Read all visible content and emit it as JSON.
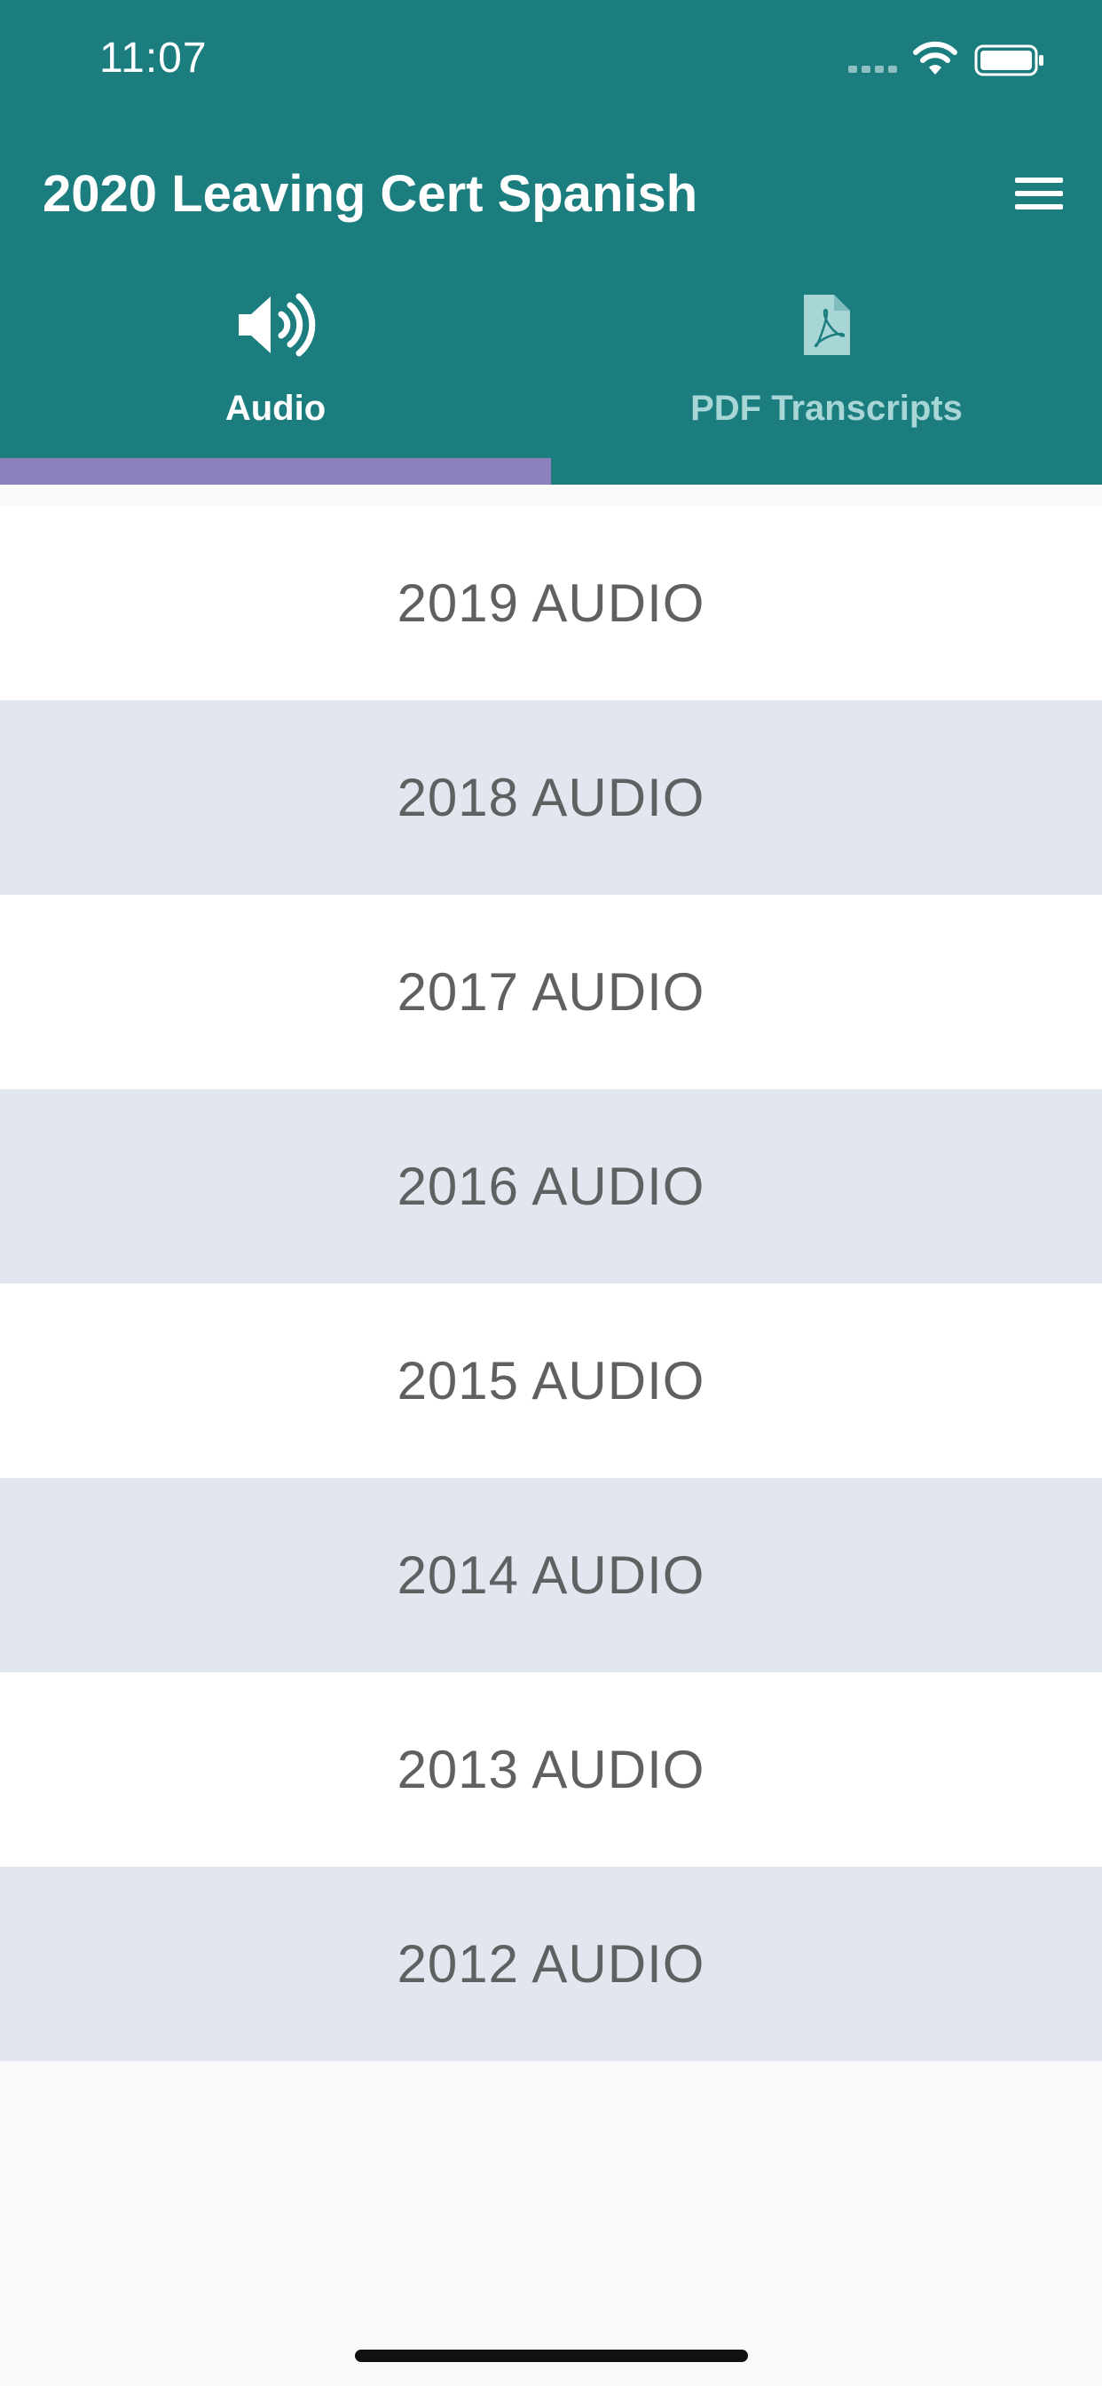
{
  "status_bar": {
    "time": "11:07"
  },
  "app_bar": {
    "title": "2020 Leaving Cert Spanish",
    "menu_icon": "hamburger-menu-icon"
  },
  "tabs": [
    {
      "label": "Audio",
      "icon": "speaker-icon",
      "selected": true
    },
    {
      "label": "PDF Transcripts",
      "icon": "pdf-file-icon",
      "selected": false
    }
  ],
  "audio_list": {
    "items": [
      {
        "label": "2019 AUDIO"
      },
      {
        "label": "2018 AUDIO"
      },
      {
        "label": "2017 AUDIO"
      },
      {
        "label": "2016 AUDIO"
      },
      {
        "label": "2015 AUDIO"
      },
      {
        "label": "2014 AUDIO"
      },
      {
        "label": "2013 AUDIO"
      },
      {
        "label": "2012 AUDIO"
      }
    ]
  },
  "colors": {
    "header_background": "#1C7D7F",
    "tab_indicator": "#8C81BD",
    "row_alt_background": "#E1E6EF",
    "row_text": "#5F6062",
    "inactive_tab_text": "#A8D6D7"
  }
}
